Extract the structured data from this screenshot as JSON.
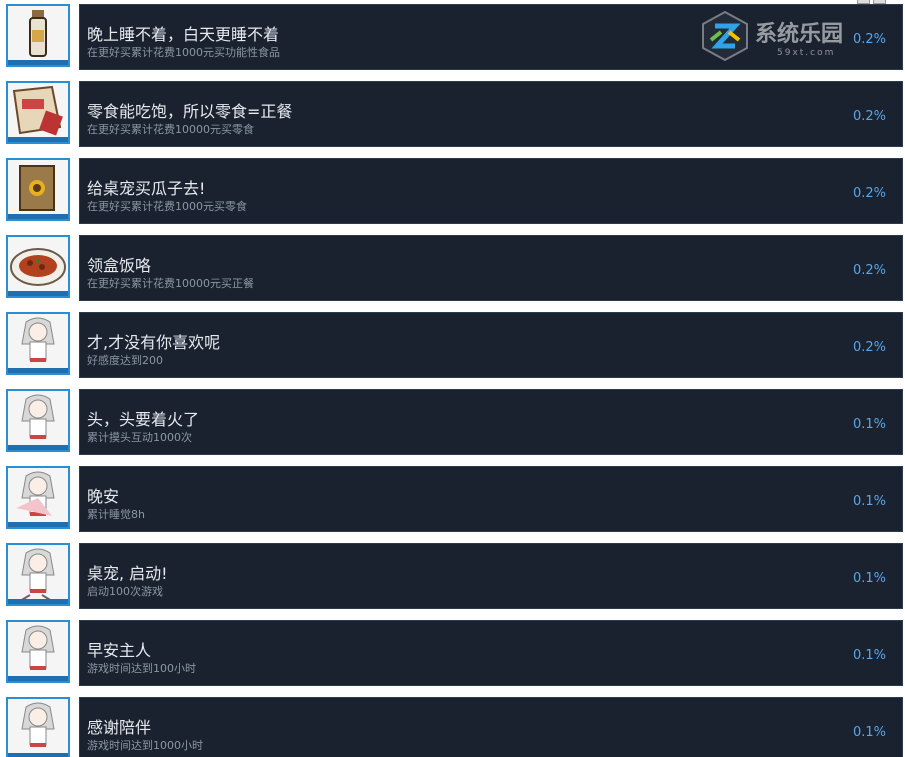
{
  "achievements": [
    {
      "title": "晚上睡不着，白天更睡不着",
      "desc": "在更好买累计花费1000元买功能性食品",
      "percent": "0.2%",
      "icon": "bottle-icon"
    },
    {
      "title": "零食能吃饱，所以零食=正餐",
      "desc": "在更好买累计花费10000元买零食",
      "percent": "0.2%",
      "icon": "snack-bag-icon"
    },
    {
      "title": "给桌宠买瓜子去!",
      "desc": "在更好买累计花费1000元买零食",
      "percent": "0.2%",
      "icon": "sunflower-seeds-icon"
    },
    {
      "title": "领盒饭咯",
      "desc": "在更好买累计花费10000元买正餐",
      "percent": "0.2%",
      "icon": "meal-plate-icon"
    },
    {
      "title": "才,才没有你喜欢呢",
      "desc": "好感度达到200",
      "percent": "0.2%",
      "icon": "pet-girl-shy-icon"
    },
    {
      "title": "头，头要着火了",
      "desc": "累计摸头互动1000次",
      "percent": "0.1%",
      "icon": "pet-girl-headpat-icon"
    },
    {
      "title": "晚安",
      "desc": "累计睡觉8h",
      "percent": "0.1%",
      "icon": "pet-girl-sleeping-icon"
    },
    {
      "title": "桌宠, 启动!",
      "desc": "启动100次游戏",
      "percent": "0.1%",
      "icon": "pet-girl-running-icon"
    },
    {
      "title": "早安主人",
      "desc": "游戏时间达到100小时",
      "percent": "0.1%",
      "icon": "pet-girl-morning-icon"
    },
    {
      "title": "感谢陪伴",
      "desc": "游戏时间达到1000小时",
      "percent": "0.1%",
      "icon": "pet-girl-thanks-icon"
    }
  ],
  "watermark": {
    "text": "系统乐园",
    "sub": "59xt.com"
  }
}
